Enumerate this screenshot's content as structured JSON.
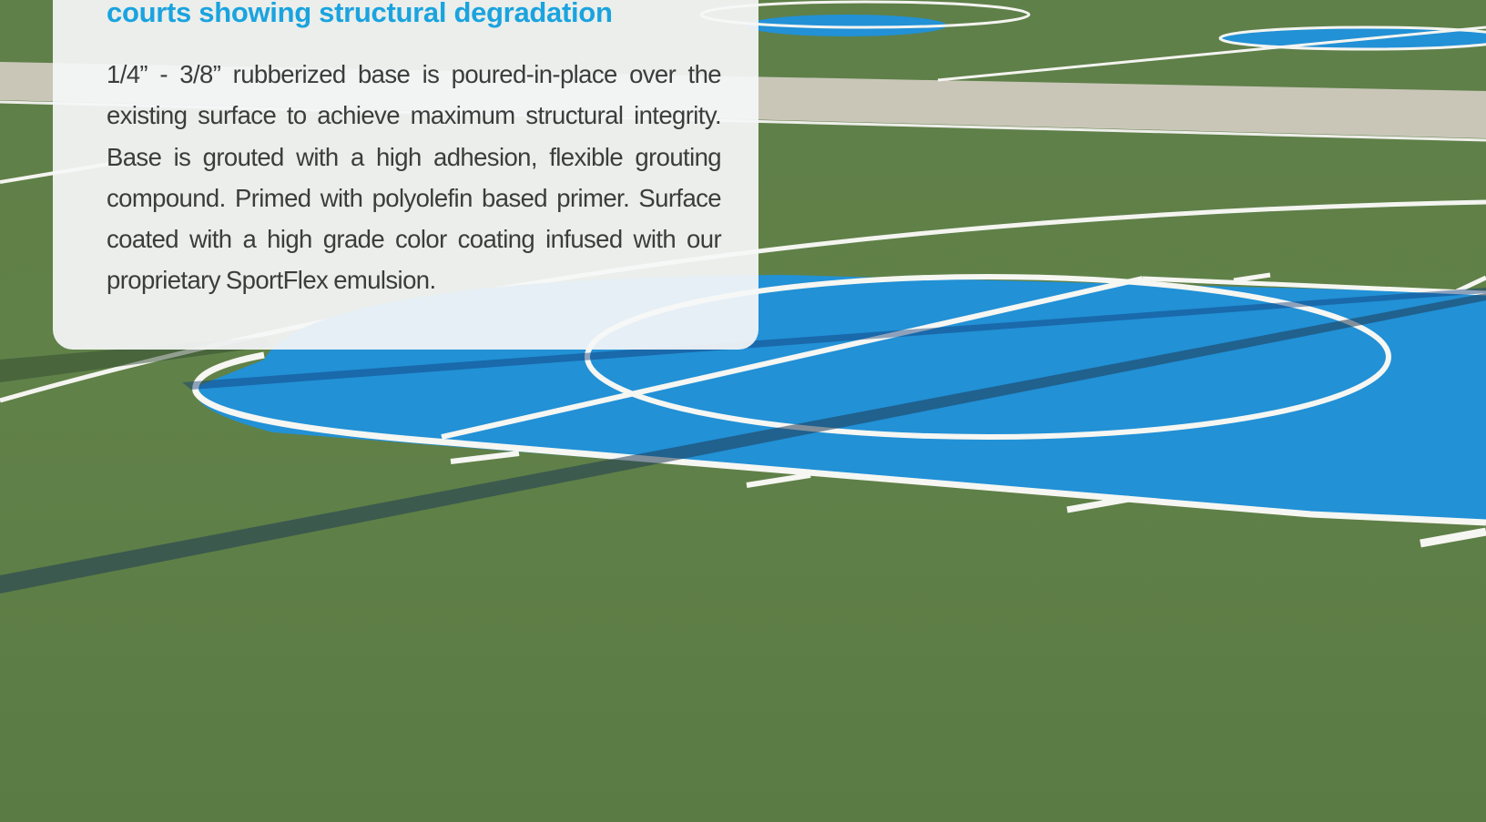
{
  "card": {
    "heading": "courts showing structural degradation",
    "body": "1/4” - 3/8” rubberized base is poured-in-place over the existing surface to achieve maximum structural integrity. Base is grouted with a high adhesion, flexible grouting compound. Primed with polyolefin based primer. Surface coated with a high grade color coating infused with our proprietary SportFlex emulsion."
  },
  "colors": {
    "heading": "#1aa3df",
    "court_green": "#5e7f48",
    "court_blue": "#2291d6",
    "line_white": "#f4f4f0",
    "walkway": "#c9c6b8",
    "card_background": "#f5f6f7"
  },
  "scene": {
    "subject": "outdoor-basketball-court-photo"
  }
}
